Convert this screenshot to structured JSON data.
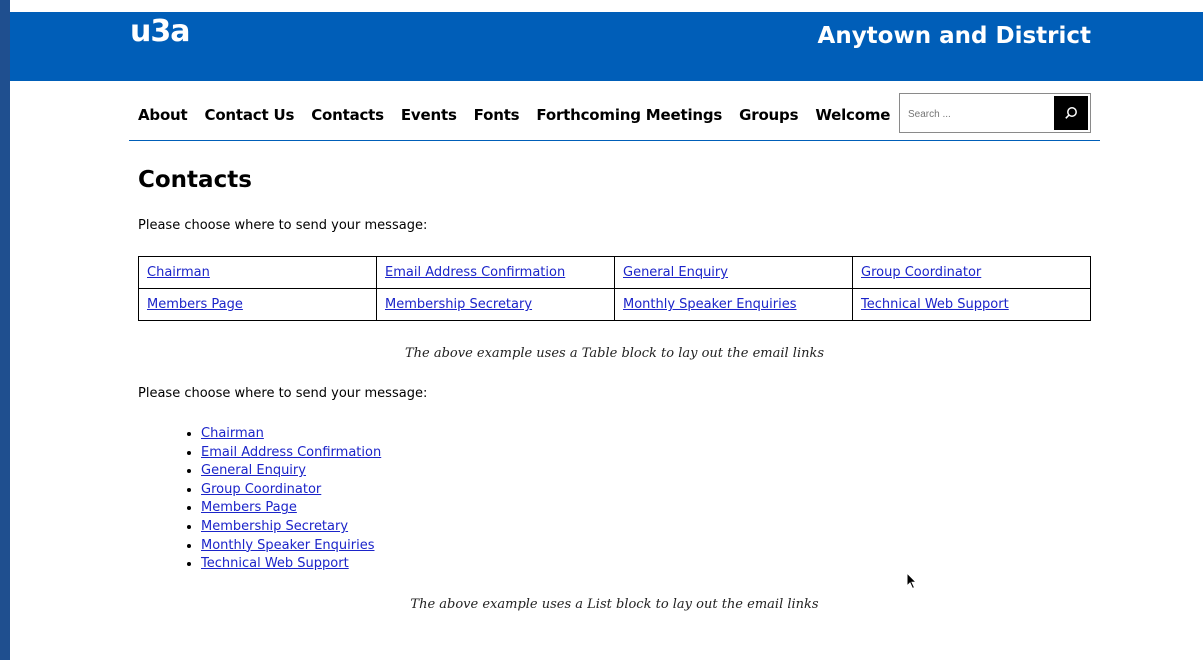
{
  "header": {
    "logo": "u3a",
    "site_title": "Anytown and District",
    "brand_color": "#005EB8"
  },
  "nav": {
    "items": [
      "About",
      "Contact Us",
      "Contacts",
      "Events",
      "Fonts",
      "Forthcoming Meetings",
      "Groups",
      "Welcome"
    ]
  },
  "search": {
    "placeholder": "Search ...",
    "icon": "search-icon"
  },
  "main": {
    "title": "Contacts",
    "intro_1": "Please choose where to send your message:",
    "table": [
      [
        "Chairman",
        "Email Address Confirmation",
        "General Enquiry",
        "Group Coordinator"
      ],
      [
        "Members Page",
        "Membership Secretary",
        "Monthly Speaker Enquiries",
        "Technical Web Support"
      ]
    ],
    "caption_1": "The above example uses a Table block to lay out the email links",
    "intro_2": "Please choose where to send your message:",
    "list": [
      "Chairman",
      "Email Address Confirmation",
      "General Enquiry",
      "Group Coordinator",
      "Members Page",
      "Membership Secretary",
      "Monthly Speaker Enquiries",
      "Technical Web Support"
    ],
    "caption_2": "The above example uses a List block to lay out the email links"
  }
}
